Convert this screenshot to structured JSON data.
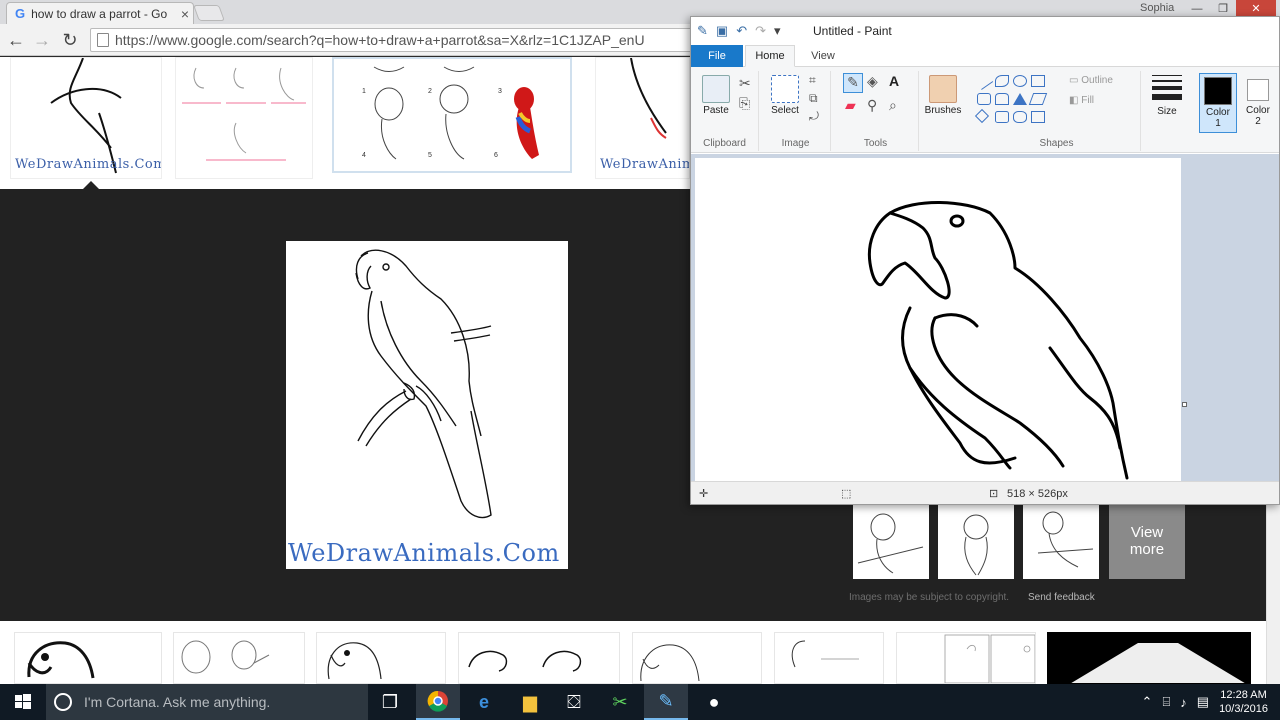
{
  "browser": {
    "tab_title": "how to draw a parrot - Go",
    "tab_close": "×",
    "profile": "Sophia",
    "win_min": "—",
    "win_max": "❐",
    "win_close": "✕",
    "back": "←",
    "forward": "→",
    "reload": "↻",
    "url": "https://www.google.com/search?q=how+to+draw+a+parrot&sa=X&rlz=1C1JZAP_enU"
  },
  "results": {
    "watermark": "WeDrawAnimals.Com",
    "preview_watermark": "WeDrawAnimals.Com",
    "view_more_line1": "View",
    "view_more_line2": "more",
    "copyright_note": "Images may be subject to copyright.",
    "send_feedback": "Send feedback",
    "step_numbers": [
      "1",
      "2",
      "3",
      "4",
      "5",
      "6"
    ]
  },
  "paint": {
    "title": "Untitled - Paint",
    "tabs": {
      "file": "File",
      "home": "Home",
      "view": "View"
    },
    "tools": {
      "paste": "Paste",
      "select": "Select",
      "brushes": "Brushes",
      "size": "Size",
      "color1": "Color",
      "color1_num": "1",
      "color2": "Color",
      "color2_num": "2",
      "outline": "Outline",
      "fill": "Fill",
      "text_tool": "A"
    },
    "groups": {
      "clipboard": "Clipboard",
      "image": "Image",
      "tools": "Tools",
      "shapes": "Shapes"
    },
    "status": {
      "dimensions": "518 × 526px"
    },
    "colors": {
      "color1": "#000000",
      "color2": "#ffffff"
    }
  },
  "taskbar": {
    "search_placeholder": "I'm Cortana. Ask me anything.",
    "time": "12:28 AM",
    "date": "10/3/2016"
  }
}
